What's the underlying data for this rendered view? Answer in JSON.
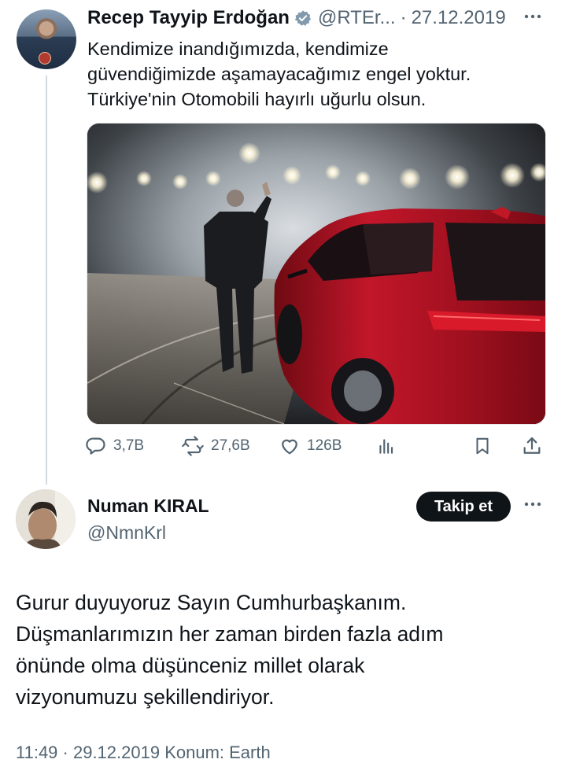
{
  "original_tweet": {
    "author_name": "Recep Tayyip Erdoğan",
    "handle": "@RTEr...",
    "separator": "·",
    "date": "27.12.2019",
    "text_lines": [
      "Kendimize inandığımızda, kendimize",
      "güvendiğimizde aşamayacağımız engel yoktur.",
      "Türkiye'nin Otomobili hayırlı uğurlu olsun."
    ],
    "stats": {
      "replies": "3,7B",
      "reposts": "27,6B",
      "likes": "126B"
    },
    "icons": [
      "verified-badge-icon",
      "more-icon",
      "reply-icon",
      "repost-icon",
      "like-icon",
      "views-icon",
      "bookmark-icon",
      "share-icon"
    ]
  },
  "reply": {
    "author_name": "Numan KIRAL",
    "handle": "@NmnKrl",
    "follow_label": "Takip et",
    "text_lines": [
      "Gurur duyuyoruz Sayın Cumhurbaşkanım.",
      "Düşmanlarımızın her zaman birden fazla adım",
      "önünde olma düşünceniz millet olarak",
      "vizyonumuzu şekillendiriyor."
    ],
    "meta": "11:49 · 29.12.2019 Konum: Earth"
  },
  "colors": {
    "text": "#0f1419",
    "secondary": "#536471",
    "verified": "#829aab",
    "follow_bg": "#0f1419",
    "car_red": "#b01020"
  }
}
